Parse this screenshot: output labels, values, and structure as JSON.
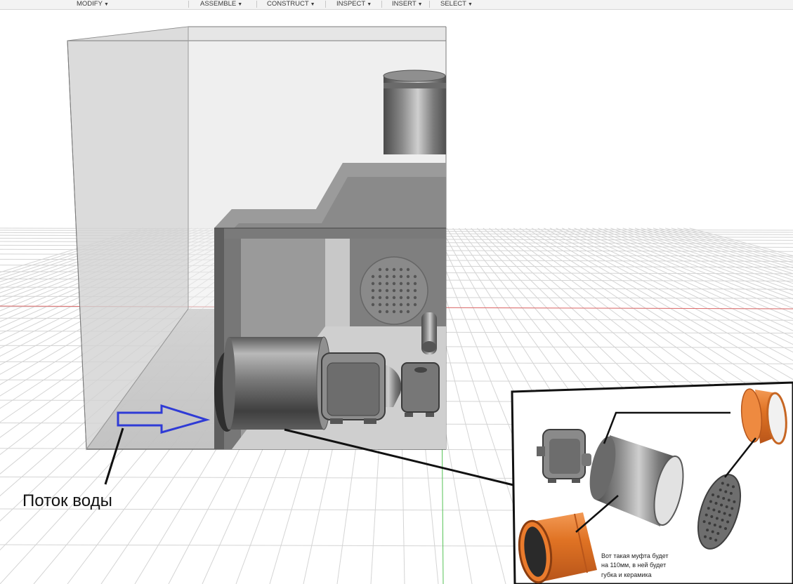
{
  "toolbar": {
    "menus": [
      {
        "label": "MODIFY"
      },
      {
        "label": "ASSEMBLE"
      },
      {
        "label": "CONSTRUCT"
      },
      {
        "label": "INSPECT"
      },
      {
        "label": "INSERT"
      },
      {
        "label": "SELECT"
      }
    ],
    "caret_icon": "caret-down-icon"
  },
  "annotation": {
    "flow_label": "Поток воды",
    "arrow_color": "#2f3bd6"
  },
  "inset": {
    "caption_lines": [
      "Вот такая муфта будет",
      "на 110мм, в ней будет",
      "губка и керамика"
    ]
  },
  "colors": {
    "pipe_orange": "#e07324",
    "axis_red": "#e06b6b",
    "axis_green": "#55c255",
    "grid": "#d4d4d4",
    "metal": "#6f6f6f"
  }
}
